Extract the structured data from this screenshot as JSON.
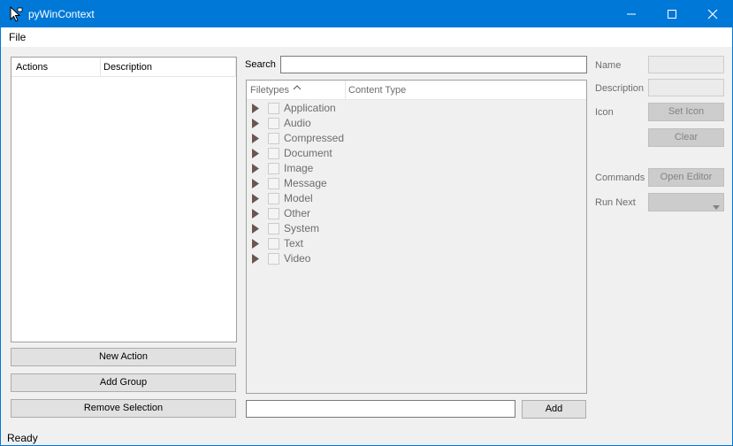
{
  "window": {
    "title": "pyWinContext"
  },
  "menu": {
    "file_label": "File"
  },
  "actions_list": {
    "columns": [
      "Actions",
      "Description"
    ],
    "rows": []
  },
  "left_buttons": {
    "new_action": "New Action",
    "add_group": "Add Group",
    "remove_selection": "Remove Selection"
  },
  "search": {
    "label": "Search",
    "value": "",
    "placeholder": ""
  },
  "filetype_tree": {
    "columns": [
      "Filetypes",
      "Content Type"
    ],
    "items": [
      {
        "label": "Application",
        "checked": false
      },
      {
        "label": "Audio",
        "checked": false
      },
      {
        "label": "Compressed",
        "checked": false
      },
      {
        "label": "Document",
        "checked": false
      },
      {
        "label": "Image",
        "checked": false
      },
      {
        "label": "Message",
        "checked": false
      },
      {
        "label": "Model",
        "checked": false
      },
      {
        "label": "Other",
        "checked": false
      },
      {
        "label": "System",
        "checked": false
      },
      {
        "label": "Text",
        "checked": false
      },
      {
        "label": "Video",
        "checked": false
      }
    ]
  },
  "add_row": {
    "input_value": "",
    "add_label": "Add"
  },
  "properties": {
    "name_label": "Name",
    "name_value": "",
    "description_label": "Description",
    "description_value": "",
    "icon_label": "Icon",
    "set_icon_label": "Set Icon",
    "clear_label": "Clear",
    "commands_label": "Commands",
    "open_editor_label": "Open Editor",
    "run_next_label": "Run Next",
    "run_next_value": ""
  },
  "status_bar": {
    "text": "Ready"
  },
  "colors": {
    "titlebar": "#0078d7",
    "expander": "#6b5550",
    "disabled_text": "#6d6d6d"
  },
  "icons": [
    "app-cursor-icon",
    "minimize-icon",
    "maximize-icon",
    "close-icon",
    "sort-ascending-icon",
    "expand-arrow-icon",
    "dropdown-arrow-icon"
  ]
}
